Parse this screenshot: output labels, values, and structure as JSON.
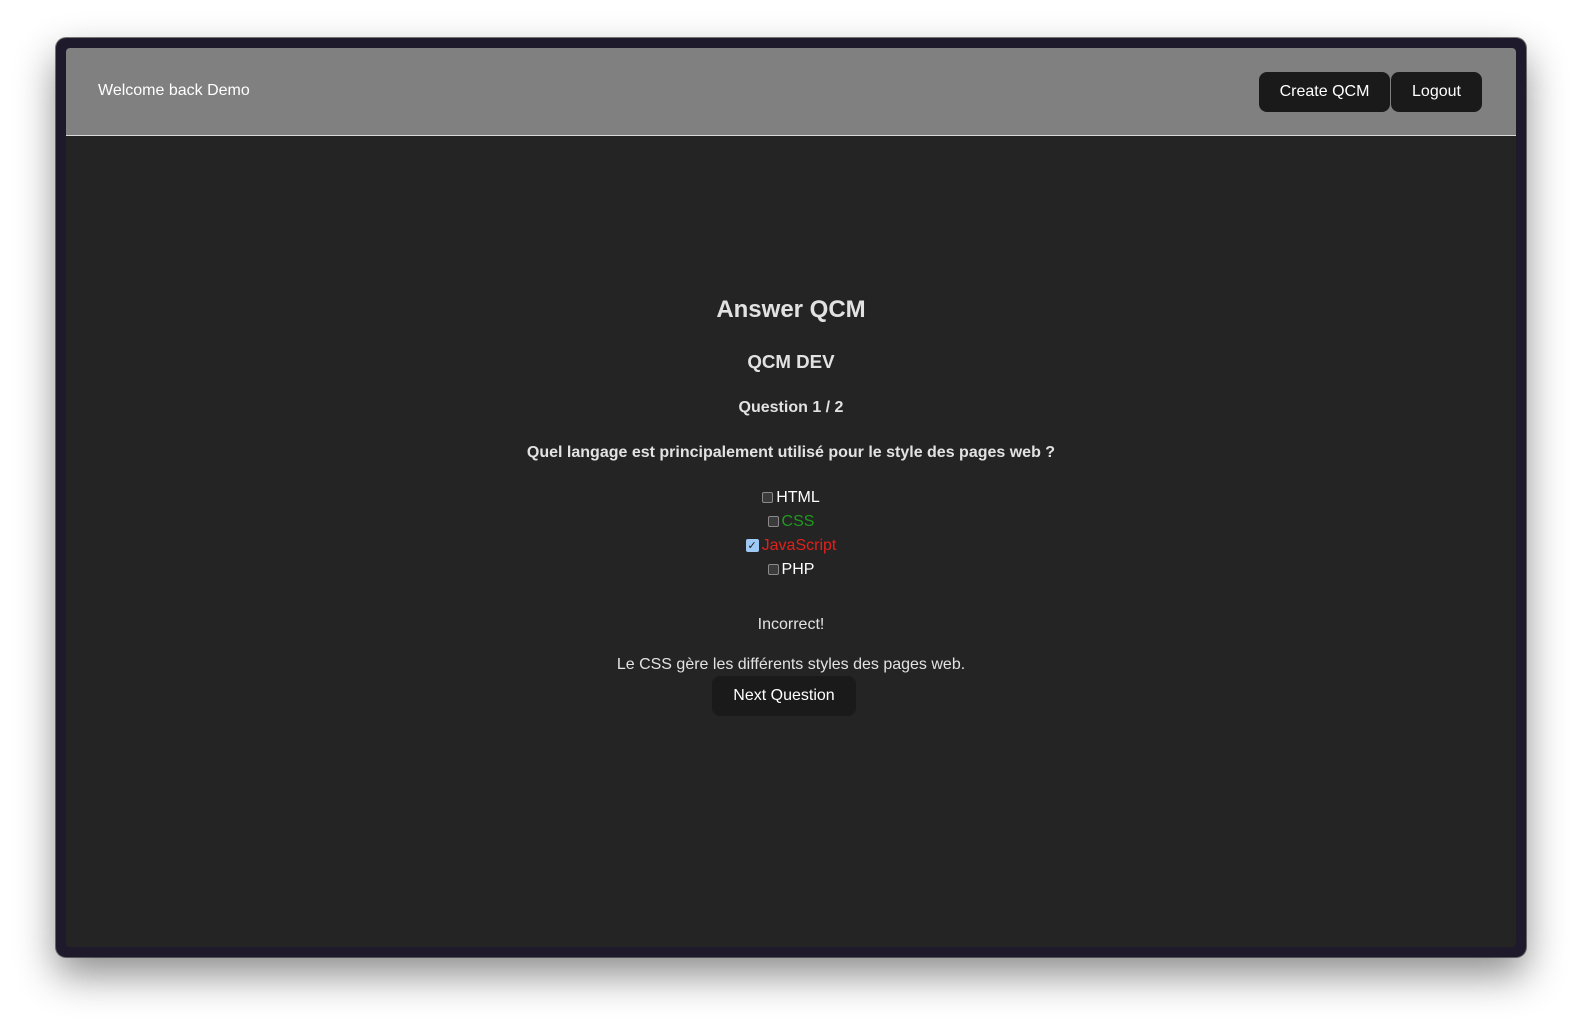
{
  "navbar": {
    "welcome_text": "Welcome back Demo",
    "create_label": "Create QCM",
    "logout_label": "Logout"
  },
  "main": {
    "title": "Answer QCM",
    "qcm_name": "QCM DEV",
    "question_counter": "Question 1 / 2",
    "question_text": "Quel langage est principalement utilisé pour le style des pages web ?",
    "options": [
      {
        "label": "HTML",
        "checked": false,
        "color": "#ffffff"
      },
      {
        "label": "CSS",
        "checked": false,
        "color": "#1f9a1f"
      },
      {
        "label": "JavaScript",
        "checked": true,
        "color": "#e0211b"
      },
      {
        "label": "PHP",
        "checked": false,
        "color": "#ffffff"
      }
    ],
    "result": "Incorrect!",
    "explanation": "Le CSS gère les différents styles des pages web.",
    "next_label": "Next Question"
  },
  "colors": {
    "navbar_bg": "#808080",
    "page_bg": "#242424",
    "button_bg": "#1a1a1a",
    "correct": "#1f9a1f",
    "incorrect": "#e0211b"
  }
}
